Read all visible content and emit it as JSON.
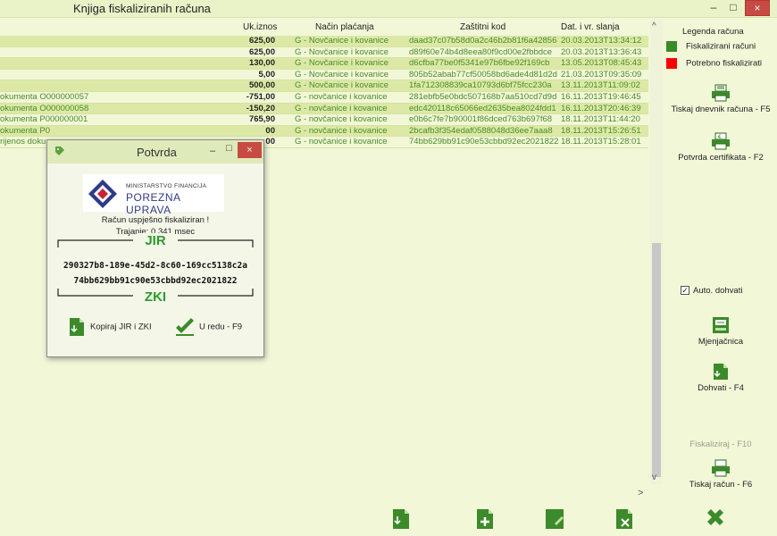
{
  "window": {
    "title": "Knjiga fiskaliziranih računa",
    "minimize": "–",
    "maximize": "□",
    "close": "×"
  },
  "table": {
    "headers": {
      "amount": "Uk.iznos",
      "payment": "Način plaćanja",
      "zki": "Zaštitni kod",
      "date": "Dat. i vr. slanja"
    },
    "rows": [
      {
        "doc": "",
        "amount": "625,00",
        "payment": "G - Novčanice i kovanice",
        "zki": "daad37c07b58d0a2c46b2b81f6a42856",
        "date": "20.03.2013T13:34:12"
      },
      {
        "doc": "",
        "amount": "625,00",
        "payment": "G - Novčanice i kovanice",
        "zki": "d89f60e74b4d8eea80f9cd00e2fbbdce",
        "date": "20.03.2013T13:36:43"
      },
      {
        "doc": "",
        "amount": "130,00",
        "payment": "G - Novčanice i kovanice",
        "zki": "d6cfba77be0f5341e97b6fbe92f169cb",
        "date": "13.05.2013T08:45:43"
      },
      {
        "doc": "",
        "amount": "5,00",
        "payment": "G - Novčanice i kovanice",
        "zki": "805b52abab77cf50058bd6ade4d81d2d",
        "date": "21.03.2013T09:35:09"
      },
      {
        "doc": "",
        "amount": "500,00",
        "payment": "G - Novčanice i kovanice",
        "zki": "1fa712308839ca10793d6bf75fcc230a",
        "date": "13.11.2013T11:09:02"
      },
      {
        "doc": "okumenta O000000057",
        "amount": "-751,00",
        "payment": "G - novčanice i kovanice",
        "zki": "281ebfb5e0bdc507168b7aa510cd7d9d",
        "date": "16.11.2013T19:46:45"
      },
      {
        "doc": "okumenta O000000058",
        "amount": "-150,20",
        "payment": "G - novčanice i kovanice",
        "zki": "edc420118c65066ed2635bea8024fdd1",
        "date": "16.11.2013T20:46:39"
      },
      {
        "doc": "okumenta P000000001",
        "amount": "765,90",
        "payment": "G - novčanice i kovanice",
        "zki": "e0b6c7fe7b90001f86dced763b697f68",
        "date": "18.11.2013T11:44:20"
      },
      {
        "doc": "okumenta P0",
        "amount": "00",
        "payment": "G - novčanice i kovanice",
        "zki": "2bcafb3f354edaf0588048d36ee7aaa8",
        "date": "18.11.2013T15:26:51"
      },
      {
        "doc": "rijenos doku",
        "amount": "00",
        "payment": "G - novčanice i kovanice",
        "zki": "74bb629bb91c90e53cbbd92ec2021822",
        "date": "18.11.2013T15:28:01"
      }
    ]
  },
  "legend": {
    "title": "Legenda računa",
    "items": [
      {
        "label": "Fiskalizirani računi",
        "color": "#3a8a2a"
      },
      {
        "label": "Potrebno fiskalizirati",
        "color": "#ff0000"
      }
    ]
  },
  "right_buttons": {
    "print_journal": "Tiskaj dnevnik računa - F5",
    "cert_confirm": "Potvrda certifikata - F2",
    "auto_fetch": "Auto. dohvati",
    "exchange": "Mjenjačnica",
    "fetch": "Dohvati - F4",
    "fiscalize": "Fiskaliziraj - F10",
    "print_invoice": "Tiskaj račun - F6"
  },
  "scroll": {
    "up": "^",
    "down": "v",
    "right": ">"
  },
  "dialog": {
    "title": "Potvrda",
    "minimize": "–",
    "maximize": "□",
    "close": "×",
    "logo_ministry": "MINISTARSTVO FINANCIJA",
    "logo_name": "POREZNA UPRAVA",
    "message": "Račun uspješno fiskaliziran !",
    "duration": "Trajanje:  0.341 msec",
    "jir_label": "JIR",
    "jir_value": "290327b8-189e-45d2-8c60-169cc5138c2a",
    "zki_value": "74bb629bb91c90e53cbbd92ec2021822",
    "zki_label": "ZKI",
    "copy_button": "Kopiraj JIR i ZKI",
    "ok_button": "U redu - F9"
  }
}
